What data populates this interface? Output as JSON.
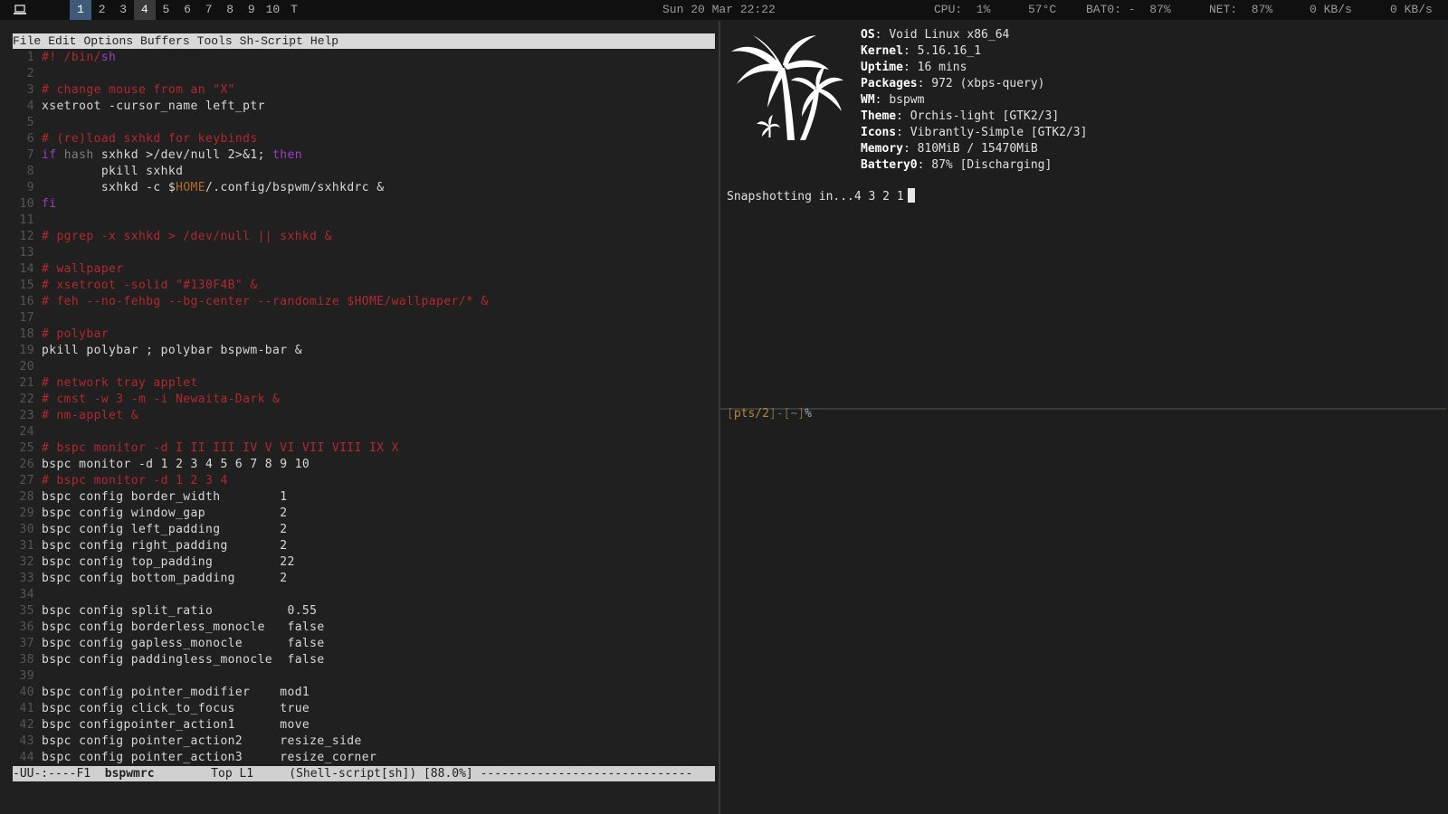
{
  "topbar": {
    "workspaces": [
      {
        "label": "1",
        "state": "active"
      },
      {
        "label": "2",
        "state": "empty"
      },
      {
        "label": "3",
        "state": "empty"
      },
      {
        "label": "4",
        "state": "occupied"
      },
      {
        "label": "5",
        "state": "empty"
      },
      {
        "label": "6",
        "state": "empty"
      },
      {
        "label": "7",
        "state": "empty"
      },
      {
        "label": "8",
        "state": "empty"
      },
      {
        "label": "9",
        "state": "empty"
      },
      {
        "label": "10",
        "state": "empty"
      },
      {
        "label": "T",
        "state": "empty"
      }
    ],
    "datetime": "Sun 20 Mar 22:22",
    "cpu": "CPU:  1%",
    "temp": "57°C",
    "battery": "BAT0: -  87%",
    "net": "NET:  87%",
    "down": "0 KB/s",
    "up": "0 KB/s"
  },
  "emacs": {
    "menu": [
      "File",
      "Edit",
      "Options",
      "Buffers",
      "Tools",
      "Sh-Script",
      "Help"
    ],
    "lines": [
      {
        "n": "1",
        "t": "#! /bin/sh",
        "c": "shebang"
      },
      {
        "n": "2",
        "t": "",
        "c": ""
      },
      {
        "n": "3",
        "t": "# change mouse from an \"X\"",
        "c": "cm"
      },
      {
        "n": "4",
        "t": "xsetroot -cursor_name left_ptr",
        "c": ""
      },
      {
        "n": "5",
        "t": "",
        "c": ""
      },
      {
        "n": "6",
        "t": "# (re)load sxhkd for keybinds",
        "c": "cm"
      },
      {
        "n": "7",
        "t": "if hash sxhkd >/dev/null 2>&1; then",
        "c": "ifline"
      },
      {
        "n": "8",
        "t": "        pkill sxhkd",
        "c": ""
      },
      {
        "n": "9",
        "t": "        sxhkd -c $HOME/.config/bspwm/sxhkdrc &",
        "c": "homeline"
      },
      {
        "n": "10",
        "t": "fi",
        "c": "kw"
      },
      {
        "n": "11",
        "t": "",
        "c": ""
      },
      {
        "n": "12",
        "t": "# pgrep -x sxhkd > /dev/null || sxhkd &",
        "c": "cm"
      },
      {
        "n": "13",
        "t": "",
        "c": ""
      },
      {
        "n": "14",
        "t": "# wallpaper",
        "c": "cm"
      },
      {
        "n": "15",
        "t": "# xsetroot -solid \"#130F4B\" &",
        "c": "cm"
      },
      {
        "n": "16",
        "t": "# feh --no-fehbg --bg-center --randomize $HOME/wallpaper/* &",
        "c": "cm"
      },
      {
        "n": "17",
        "t": "",
        "c": ""
      },
      {
        "n": "18",
        "t": "# polybar",
        "c": "cm"
      },
      {
        "n": "19",
        "t": "pkill polybar ; polybar bspwm-bar &",
        "c": ""
      },
      {
        "n": "20",
        "t": "",
        "c": ""
      },
      {
        "n": "21",
        "t": "# network tray applet",
        "c": "cm"
      },
      {
        "n": "22",
        "t": "# cmst -w 3 -m -i Newaita-Dark &",
        "c": "cm"
      },
      {
        "n": "23",
        "t": "# nm-applet &",
        "c": "cm"
      },
      {
        "n": "24",
        "t": "",
        "c": ""
      },
      {
        "n": "25",
        "t": "# bspc monitor -d I II III IV V VI VII VIII IX X",
        "c": "cm"
      },
      {
        "n": "26",
        "t": "bspc monitor -d 1 2 3 4 5 6 7 8 9 10",
        "c": ""
      },
      {
        "n": "27",
        "t": "# bspc monitor -d 1 2 3 4",
        "c": "cm"
      },
      {
        "n": "28",
        "t": "bspc config border_width        1",
        "c": ""
      },
      {
        "n": "29",
        "t": "bspc config window_gap          2",
        "c": ""
      },
      {
        "n": "30",
        "t": "bspc config left_padding        2",
        "c": ""
      },
      {
        "n": "31",
        "t": "bspc config right_padding       2",
        "c": ""
      },
      {
        "n": "32",
        "t": "bspc config top_padding         22",
        "c": ""
      },
      {
        "n": "33",
        "t": "bspc config bottom_padding      2",
        "c": ""
      },
      {
        "n": "34",
        "t": "",
        "c": ""
      },
      {
        "n": "35",
        "t": "bspc config split_ratio          0.55",
        "c": ""
      },
      {
        "n": "36",
        "t": "bspc config borderless_monocle   false",
        "c": ""
      },
      {
        "n": "37",
        "t": "bspc config gapless_monocle      false",
        "c": ""
      },
      {
        "n": "38",
        "t": "bspc config paddingless_monocle  false",
        "c": ""
      },
      {
        "n": "39",
        "t": "",
        "c": ""
      },
      {
        "n": "40",
        "t": "bspc config pointer_modifier    mod1",
        "c": ""
      },
      {
        "n": "41",
        "t": "bspc config click_to_focus      true",
        "c": ""
      },
      {
        "n": "42",
        "t": "bspc configpointer_action1      move",
        "c": ""
      },
      {
        "n": "43",
        "t": "bspc config pointer_action2     resize_side",
        "c": ""
      },
      {
        "n": "44",
        "t": "bspc config pointer_action3     resize_corner",
        "c": ""
      }
    ],
    "modeline": {
      "status": "-UU-:----F1  ",
      "buffer": "bspwmrc",
      "position": "        Top L1     ",
      "mode": "(Shell-script[sh]) [88.0%] ------------------------------"
    }
  },
  "fetch": {
    "info": [
      {
        "k": "OS",
        "v": "Void Linux x86_64"
      },
      {
        "k": "Kernel",
        "v": "5.16.16_1"
      },
      {
        "k": "Uptime",
        "v": "16 mins"
      },
      {
        "k": "Packages",
        "v": "972 (xbps-query)"
      },
      {
        "k": "WM",
        "v": "bspwm"
      },
      {
        "k": "Theme",
        "v": "Orchis-light [GTK2/3]"
      },
      {
        "k": "Icons",
        "v": "Vibrantly-Simple [GTK2/3]"
      },
      {
        "k": "Memory",
        "v": "810MiB / 15470MiB"
      },
      {
        "k": "Battery0",
        "v": "87% [Discharging]"
      }
    ],
    "snapshot": "Snapshotting in...4 3 2 1"
  },
  "prompt": {
    "pts": "pts/2",
    "dir": "~",
    "symbol": "%"
  },
  "colors": {
    "comment": "#b2282e",
    "keyword": "#9a3fc7",
    "variable": "#b06b2c",
    "active_workspace": "#3e5a7a"
  }
}
